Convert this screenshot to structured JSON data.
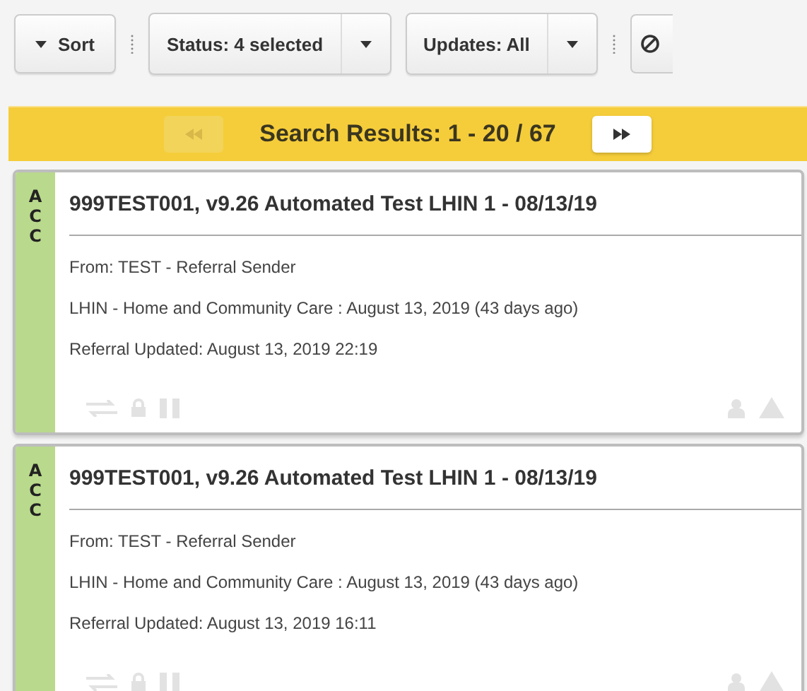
{
  "toolbar": {
    "sort": {
      "label": "Sort"
    },
    "filters": [
      {
        "label": "Status: 4 selected"
      },
      {
        "label": "Updates: All"
      }
    ]
  },
  "results_bar": {
    "title": "Search Results: 1 - 20 / 67",
    "prev": {
      "disabled": true
    },
    "next": {
      "disabled": false
    }
  },
  "referrals": [
    {
      "status": "ACC",
      "color": "#b9d98c",
      "title": "999TEST001, v9.26 Automated Test LHIN 1 - 08/13/19",
      "lines": [
        "From: TEST - Referral Sender",
        "LHIN - Home and Community Care : August 13, 2019 (43 days ago)",
        "Referral Updated: August 13, 2019 22:19"
      ]
    },
    {
      "status": "ACC",
      "color": "#b9d98c",
      "title": "999TEST001, v9.26 Automated Test LHIN 1 - 08/13/19",
      "lines": [
        "From: TEST - Referral Sender",
        "LHIN - Home and Community Care : August 13, 2019 (43 days ago)",
        "Referral Updated: August 13, 2019 16:11"
      ]
    }
  ]
}
